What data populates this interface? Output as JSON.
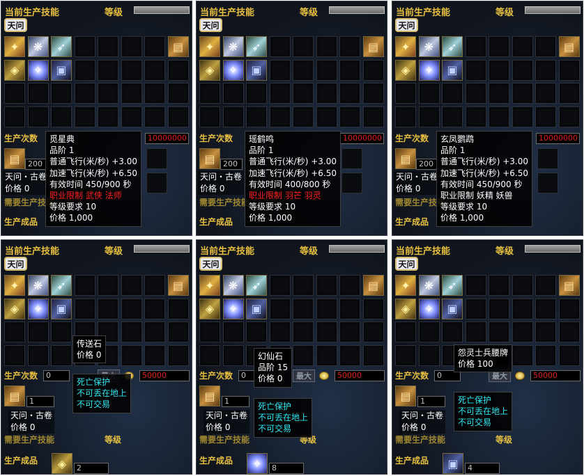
{
  "common": {
    "header_title": "当前生产技能",
    "header_level": "等级",
    "tab_label": "天问",
    "produce_count_label": "生产次数",
    "required_skill_label": "需要生产技能",
    "product_label": "生产成品",
    "max_button": "最大",
    "scroll_name": "天问・古卷",
    "scroll_price": "价格 0",
    "colors": {
      "gold": "#e8c040",
      "red": "#ff2020",
      "cyan": "#30e8f0"
    }
  },
  "top_panels": [
    {
      "count_value": "200",
      "coin_total": "10000000",
      "tooltip": {
        "name": "觅星典",
        "lines": [
          "品阶 1",
          "普通飞行(米/秒) +3.00",
          "加速飞行(米/秒) +6.50",
          "有效时间 450/900 秒"
        ],
        "restriction": "职业限制 武侠 法师",
        "restriction_red": true,
        "after": [
          "等级要求 10",
          "价格 1,000"
        ]
      }
    },
    {
      "count_value": "200",
      "coin_total": "10000000",
      "tooltip": {
        "name": "瑶鹤鸣",
        "lines": [
          "品阶 1",
          "普通飞行(米/秒) +3.00",
          "加速飞行(米/秒) +6.50",
          "有效时间 400/800 秒"
        ],
        "restriction": "职业限制 羽芒 羽灵",
        "restriction_red": true,
        "after": [
          "等级要求 10",
          "价格 1,000"
        ]
      }
    },
    {
      "count_value": "200",
      "coin_total": "10000000",
      "tooltip": {
        "name": "玄凤鹦鹉",
        "lines": [
          "品阶 1",
          "普通飞行(米/秒) +3.00",
          "加速飞行(米/秒) +6.50",
          "有效时间 450/900 秒"
        ],
        "restriction": "职业限制 妖精 妖兽",
        "restriction_red": false,
        "after": [
          "等级要求 10",
          "价格 1,000"
        ]
      }
    }
  ],
  "bottom_panels": [
    {
      "count_value": "0",
      "coin_total": "50000",
      "stone_name": "传送石",
      "stone_lines": [
        "价格 0"
      ],
      "protect": [
        "死亡保护",
        "不可丢在地上",
        "不可交易"
      ],
      "scroll_qty": "1",
      "product_qty": "2"
    },
    {
      "count_value": "0",
      "coin_total": "50000",
      "stone_name": "幻仙石",
      "stone_lines": [
        "品阶 15",
        "价格 0"
      ],
      "protect": [
        "死亡保护",
        "不可丢在地上",
        "不可交易"
      ],
      "scroll_qty": "1",
      "product_qty": "8"
    },
    {
      "count_value": "0",
      "coin_total": "50000",
      "stone_name": "怨灵士兵腰牌",
      "stone_lines": [
        "价格 100"
      ],
      "protect": [
        "死亡保护",
        "不可丢在地上",
        "不可交易"
      ],
      "scroll_qty": "1",
      "product_qty": "4"
    }
  ]
}
